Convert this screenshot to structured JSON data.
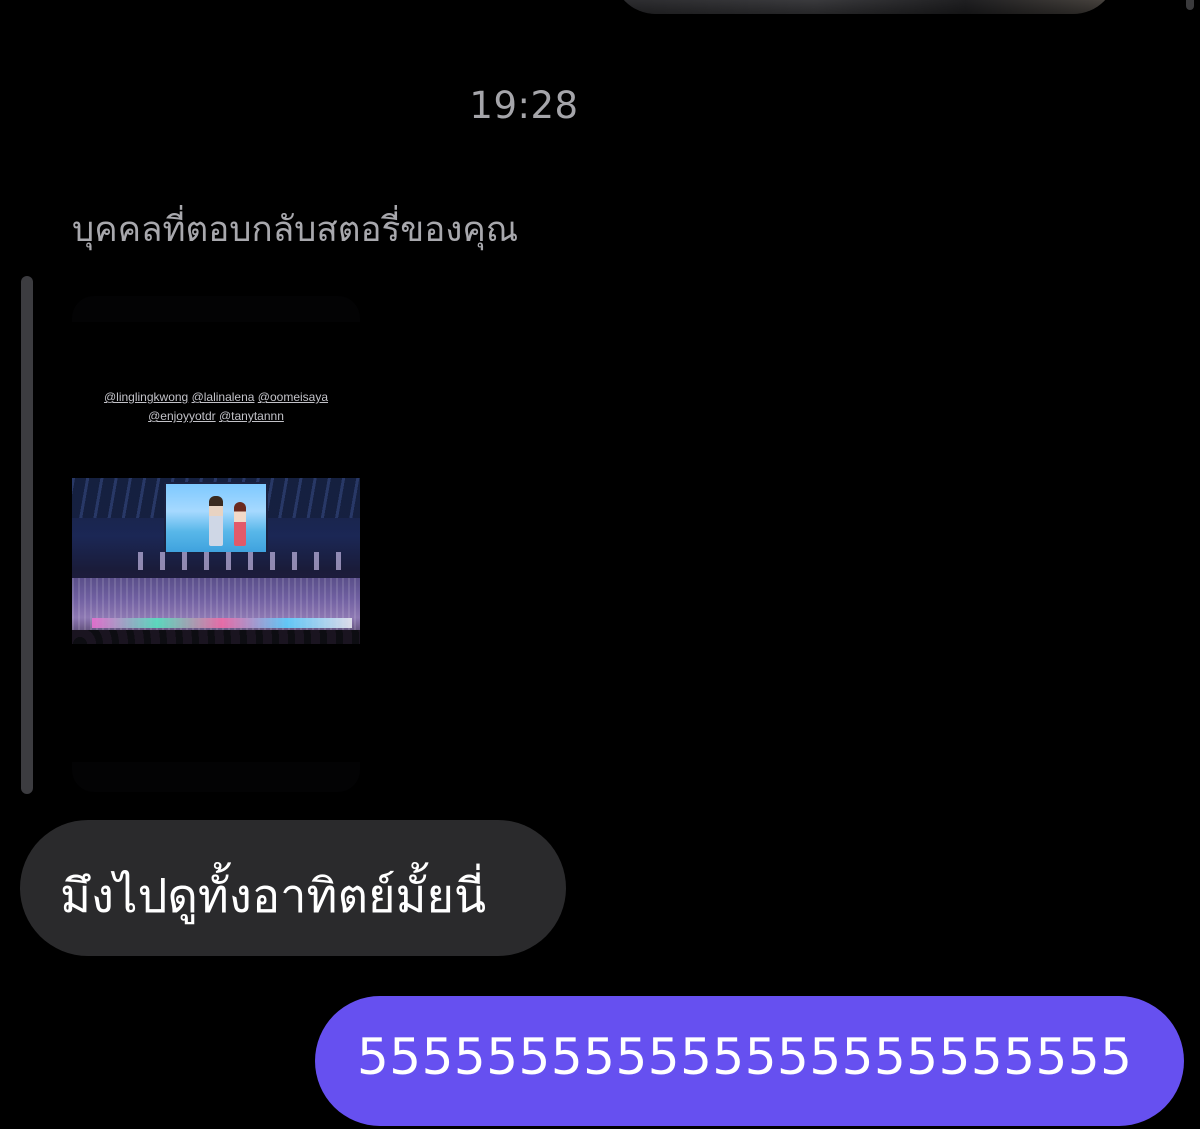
{
  "conversation": {
    "timestamp": "19:28",
    "story_reply": {
      "caption": "บุคคลที่ตอบกลับสตอรี่ของคุณ",
      "story": {
        "mentions_line1": [
          "@linglingkwong",
          "@lalinalena",
          "@oomeisaya"
        ],
        "mentions_line2": [
          "@enjoyyotdr",
          "@tanytannn"
        ]
      }
    },
    "messages": [
      {
        "direction": "incoming",
        "text": "มึงไปดูทั้งอาทิตย์มั้ยนี่"
      },
      {
        "direction": "outgoing",
        "text": "555555555555555555555555"
      }
    ]
  },
  "colors": {
    "background": "#000000",
    "incoming_bubble": "#2a2a2c",
    "outgoing_bubble": "#6650f0",
    "secondary_text": "#a8a8ad"
  }
}
